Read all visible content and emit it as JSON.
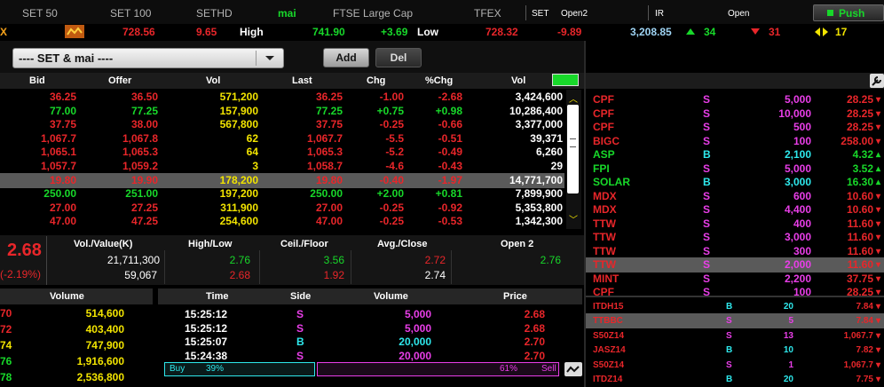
{
  "colors": {
    "up": "#18d82a",
    "down": "#e8262a",
    "unch": "#f2e400",
    "buy": "#2ee8ec",
    "sell": "#e93ee8",
    "bg": "#000000"
  },
  "top_tabs": [
    {
      "label": "SET 50",
      "color": "#b3b3b3"
    },
    {
      "label": "SET 100",
      "color": "#b3b3b3"
    },
    {
      "label": "SETHD",
      "color": "#b3b3b3"
    },
    {
      "label": "mai",
      "color": "#18d82a"
    },
    {
      "label": "FTSE Large Cap",
      "color": "#b3b3b3"
    },
    {
      "label": "TFEX",
      "color": "#b3b3b3"
    }
  ],
  "market": {
    "set_label": "SET",
    "set_status": "Open2",
    "ir_label": "IR",
    "ir_status": "Open",
    "push_label": "Push"
  },
  "ticker": {
    "prefix": "X",
    "v1": "728.56",
    "v2": "9.65",
    "high_label": "High",
    "high_value": "741.90",
    "high_change": "+3.69",
    "low_label": "Low",
    "low_value": "728.32",
    "low_change": "-9.89",
    "volume": "3,208.85",
    "up_count": "34",
    "down_count": "31",
    "unch_count": "17"
  },
  "selector": {
    "value": "---- SET & mai ----",
    "add": "Add",
    "del": "Del"
  },
  "main_table": {
    "headers": [
      "Bid",
      "Offer",
      "Vol",
      "Last",
      "Chg",
      "%Chg",
      "Vol"
    ],
    "rows": [
      {
        "bid": "36.25",
        "offer": "36.50",
        "vol": "571,200",
        "last": "36.25",
        "chg": "-1.00",
        "pchg": "-2.68",
        "tvol": "3,424,600",
        "color": "#e8262a"
      },
      {
        "bid": "77.00",
        "offer": "77.25",
        "vol": "157,900",
        "last": "77.25",
        "chg": "+0.75",
        "pchg": "+0.98",
        "tvol": "10,286,400",
        "color": "#18d82a"
      },
      {
        "bid": "37.75",
        "offer": "38.00",
        "vol": "567,800",
        "last": "37.75",
        "chg": "-0.25",
        "pchg": "-0.66",
        "tvol": "3,377,000",
        "color": "#e8262a"
      },
      {
        "bid": "1,067.7",
        "offer": "1,067.8",
        "vol": "62",
        "last": "1,067.7",
        "chg": "-5.5",
        "pchg": "-0.51",
        "tvol": "39,371",
        "color": "#e8262a"
      },
      {
        "bid": "1,065.1",
        "offer": "1,065.3",
        "vol": "64",
        "last": "1,065.3",
        "chg": "-5.2",
        "pchg": "-0.49",
        "tvol": "6,260",
        "color": "#e8262a"
      },
      {
        "bid": "1,057.7",
        "offer": "1,059.2",
        "vol": "3",
        "last": "1,058.7",
        "chg": "-4.6",
        "pchg": "-0.43",
        "tvol": "29",
        "color": "#e8262a"
      },
      {
        "bid": "19.80",
        "offer": "19.90",
        "vol": "178,200",
        "last": "19.80",
        "chg": "-0.40",
        "pchg": "-1.97",
        "tvol": "14,771,700",
        "color": "#e8262a",
        "selected": true
      },
      {
        "bid": "250.00",
        "offer": "251.00",
        "vol": "197,200",
        "last": "250.00",
        "chg": "+2.00",
        "pchg": "+0.81",
        "tvol": "7,899,900",
        "color": "#18d82a"
      },
      {
        "bid": "27.00",
        "offer": "27.25",
        "vol": "311,900",
        "last": "27.00",
        "chg": "-0.25",
        "pchg": "-0.92",
        "tvol": "5,353,800",
        "color": "#e8262a"
      },
      {
        "bid": "47.00",
        "offer": "47.25",
        "vol": "254,600",
        "last": "47.00",
        "chg": "-0.25",
        "pchg": "-0.53",
        "tvol": "1,342,300",
        "color": "#e8262a"
      }
    ]
  },
  "quote": {
    "last": "2.68",
    "change_pct": "(-2.19%)",
    "headers": [
      "Vol./Value(K)",
      "High/Low",
      "Ceil./Floor",
      "Avg./Close",
      "Open 2"
    ],
    "volume": "21,711,300",
    "value": "59,067",
    "high": "2.76",
    "low": "2.68",
    "ceil": "3.56",
    "floor": "1.92",
    "avg": "2.72",
    "close": "2.74",
    "open2": "2.76"
  },
  "bidoffer": {
    "header": "Volume",
    "rows": [
      {
        "p": "70",
        "v": "514,600"
      },
      {
        "p": "72",
        "v": "403,400"
      },
      {
        "p": "74",
        "v": "747,900"
      },
      {
        "p": "76",
        "v": "1,916,600"
      },
      {
        "p": "78",
        "v": "2,536,800"
      }
    ]
  },
  "ticks": {
    "headers": [
      "Time",
      "Side",
      "Volume",
      "Price"
    ],
    "rows": [
      {
        "time": "15:25:12",
        "side": "S",
        "vol": "5,000",
        "price": "2.68"
      },
      {
        "time": "15:25:12",
        "side": "S",
        "vol": "5,000",
        "price": "2.68"
      },
      {
        "time": "15:25:07",
        "side": "B",
        "vol": "20,000",
        "price": "2.70"
      },
      {
        "time": "15:24:38",
        "side": "S",
        "vol": "20,000",
        "price": "2.70"
      }
    ],
    "buy_label": "Buy",
    "buy_pct": "39%",
    "buy_fraction": 0.39,
    "sell_pct": "61%",
    "sell_label": "Sell"
  },
  "tradeticker": [
    {
      "sym": "CPF",
      "side": "S",
      "vol": "5,000",
      "price": "28.25",
      "color": "#e8262a"
    },
    {
      "sym": "CPF",
      "side": "S",
      "vol": "10,000",
      "price": "28.25",
      "color": "#e8262a"
    },
    {
      "sym": "CPF",
      "side": "S",
      "vol": "500",
      "price": "28.25",
      "color": "#e8262a"
    },
    {
      "sym": "BIGC",
      "side": "S",
      "vol": "100",
      "price": "258.00",
      "color": "#e8262a"
    },
    {
      "sym": "ASP",
      "side": "B",
      "vol": "2,100",
      "price": "4.32",
      "color": "#18d82a"
    },
    {
      "sym": "FPI",
      "side": "S",
      "vol": "5,000",
      "price": "3.52",
      "color": "#18d82a"
    },
    {
      "sym": "SOLAR",
      "side": "B",
      "vol": "3,000",
      "price": "16.30",
      "color": "#18d82a"
    },
    {
      "sym": "MDX",
      "side": "S",
      "vol": "600",
      "price": "10.60",
      "color": "#e8262a"
    },
    {
      "sym": "MDX",
      "side": "S",
      "vol": "4,400",
      "price": "10.60",
      "color": "#e8262a"
    },
    {
      "sym": "TTW",
      "side": "S",
      "vol": "400",
      "price": "11.60",
      "color": "#e8262a"
    },
    {
      "sym": "TTW",
      "side": "S",
      "vol": "3,000",
      "price": "11.60",
      "color": "#e8262a"
    },
    {
      "sym": "TTW",
      "side": "S",
      "vol": "300",
      "price": "11.60",
      "color": "#e8262a"
    },
    {
      "sym": "TTW",
      "side": "S",
      "vol": "2,000",
      "price": "11.60",
      "color": "#e8262a",
      "selected": true
    },
    {
      "sym": "MINT",
      "side": "S",
      "vol": "2,200",
      "price": "37.75",
      "color": "#e8262a"
    },
    {
      "sym": "CPF",
      "side": "S",
      "vol": "100",
      "price": "28.25",
      "color": "#e8262a"
    }
  ],
  "derivticker": [
    {
      "sym": "ITDH15",
      "side": "B",
      "vol": "20",
      "price": "7.84",
      "color": "#e8262a"
    },
    {
      "sym": "TTBBC",
      "side": "S",
      "vol": "5",
      "price": "7.84",
      "color": "#e8262a",
      "selected": true
    },
    {
      "sym": "S50Z14",
      "side": "S",
      "vol": "13",
      "price": "1,067.7",
      "color": "#e8262a"
    },
    {
      "sym": "JASZ14",
      "side": "B",
      "vol": "10",
      "price": "7.82",
      "color": "#e8262a"
    },
    {
      "sym": "S50Z14",
      "side": "S",
      "vol": "1",
      "price": "1,067.7",
      "color": "#e8262a"
    },
    {
      "sym": "ITDZ14",
      "side": "B",
      "vol": "20",
      "price": "7.75",
      "color": "#e8262a"
    }
  ]
}
